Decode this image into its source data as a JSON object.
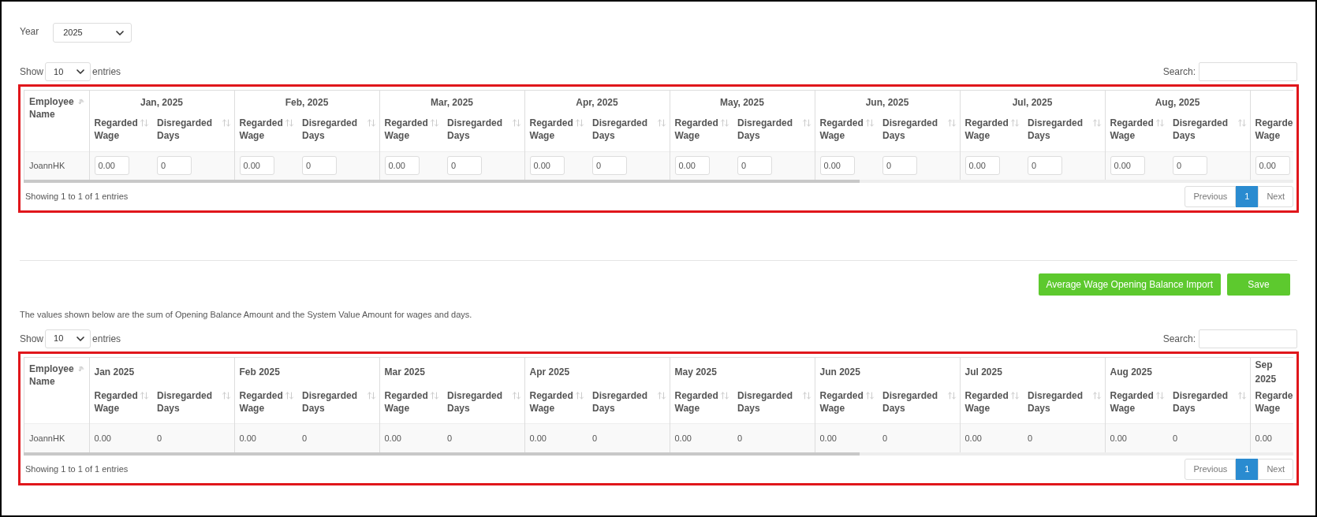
{
  "year": {
    "label": "Year",
    "value": "2025"
  },
  "tables": [
    {
      "kind": "input",
      "length": {
        "before": "Show",
        "value": "10",
        "after": "entries"
      },
      "search": {
        "label": "Search:"
      },
      "first_column": "Employee Name",
      "months": [
        {
          "label": "Jan, 2025",
          "columns": [
            "Regarded Wage",
            "Disregarded Days"
          ]
        },
        {
          "label": "Feb, 2025",
          "columns": [
            "Regarded Wage",
            "Disregarded Days"
          ]
        },
        {
          "label": "Mar, 2025",
          "columns": [
            "Regarded Wage",
            "Disregarded Days"
          ]
        },
        {
          "label": "Apr, 2025",
          "columns": [
            "Regarded Wage",
            "Disregarded Days"
          ]
        },
        {
          "label": "May, 2025",
          "columns": [
            "Regarded Wage",
            "Disregarded Days"
          ]
        },
        {
          "label": "Jun, 2025",
          "columns": [
            "Regarded Wage",
            "Disregarded Days"
          ]
        },
        {
          "label": "Jul, 2025",
          "columns": [
            "Regarded Wage",
            "Disregarded Days"
          ]
        },
        {
          "label": "Aug, 2025",
          "columns": [
            "Regarded Wage",
            "Disregarded Days"
          ]
        },
        {
          "columns": [
            "Regarde Wage"
          ]
        }
      ],
      "rows": [
        {
          "name": "JoannHK",
          "cells": [
            "0.00",
            "0",
            "0.00",
            "0",
            "0.00",
            "0",
            "0.00",
            "0",
            "0.00",
            "0",
            "0.00",
            "0",
            "0.00",
            "0",
            "0.00",
            "0",
            "0.00"
          ]
        }
      ],
      "info": "Showing 1 to 1 of 1 entries",
      "pagination": [
        {
          "label": "Previous",
          "selected": false
        },
        {
          "label": "1",
          "selected": true
        },
        {
          "label": "Next",
          "selected": false
        }
      ]
    },
    {
      "kind": "text",
      "note": "The values shown below are the sum of Opening Balance Amount and the System Value Amount for wages and days.",
      "length": {
        "before": "Show",
        "value": "10",
        "after": "entries"
      },
      "search": {
        "label": "Search:"
      },
      "first_column": "Employee Name",
      "months": [
        {
          "label": "Jan 2025",
          "columns": [
            "Regarded Wage",
            "Disregarded Days"
          ]
        },
        {
          "label": "Feb 2025",
          "columns": [
            "Regarded Wage",
            "Disregarded Days"
          ]
        },
        {
          "label": "Mar 2025",
          "columns": [
            "Regarded Wage",
            "Disregarded Days"
          ]
        },
        {
          "label": "Apr 2025",
          "columns": [
            "Regarded Wage",
            "Disregarded Days"
          ]
        },
        {
          "label": "May 2025",
          "columns": [
            "Regarded Wage",
            "Disregarded Days"
          ]
        },
        {
          "label": "Jun 2025",
          "columns": [
            "Regarded Wage",
            "Disregarded Days"
          ]
        },
        {
          "label": "Jul 2025",
          "columns": [
            "Regarded Wage",
            "Disregarded Days"
          ]
        },
        {
          "label": "Aug 2025",
          "columns": [
            "Regarded Wage",
            "Disregarded Days"
          ]
        },
        {
          "label": "Sep 2025",
          "columns": [
            "Regarde Wage"
          ]
        }
      ],
      "rows": [
        {
          "name": "JoannHK",
          "cells": [
            "0.00",
            "0",
            "0.00",
            "0",
            "0.00",
            "0",
            "0.00",
            "0",
            "0.00",
            "0",
            "0.00",
            "0",
            "0.00",
            "0",
            "0.00",
            "0",
            "0.00"
          ]
        }
      ],
      "info": "Showing 1 to 1 of 1 entries",
      "pagination": [
        {
          "label": "Previous",
          "selected": false
        },
        {
          "label": "1",
          "selected": true
        },
        {
          "label": "Next",
          "selected": false
        }
      ]
    }
  ],
  "buttons": [
    {
      "label": "Average Wage Opening Balance Import"
    },
    {
      "label": "Save"
    }
  ]
}
